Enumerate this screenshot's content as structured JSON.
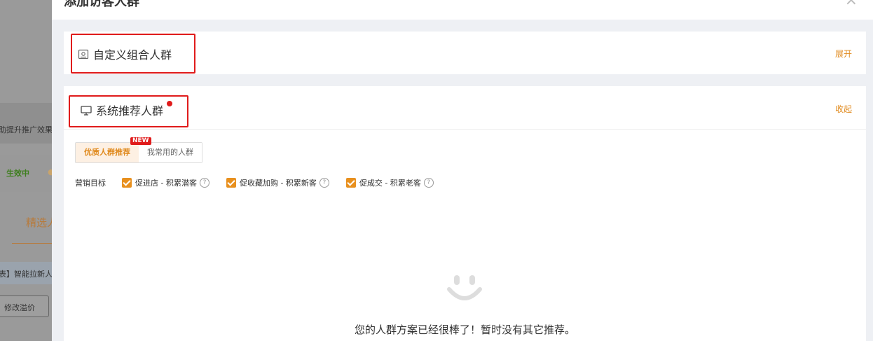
{
  "background": {
    "strip1_text": "助提升推广效果",
    "status_text": "生效中",
    "tab_text": "精选人",
    "row_text": "表】智能拉新人",
    "button_label": "修改溢价"
  },
  "modal": {
    "title": "添加访客人群"
  },
  "custom_panel": {
    "title": "自定义组合人群",
    "action": "展开"
  },
  "system_panel": {
    "title": "系统推荐人群",
    "action": "收起",
    "tabs": [
      {
        "label": "优质人群推荐",
        "active": true
      },
      {
        "label": "我常用的人群",
        "active": false
      }
    ],
    "new_badge": "NEW",
    "goal_label": "营销目标",
    "goals": [
      {
        "label": "促进店 - 积累潜客",
        "checked": true
      },
      {
        "label": "促收藏加购 - 积累新客",
        "checked": true
      },
      {
        "label": "促成交 - 积累老客",
        "checked": true
      }
    ],
    "empty_text": "您的人群方案已经很棒了！暂时没有其它推荐。"
  },
  "colors": {
    "accent": "#e08a1e",
    "highlight_box": "#e01b1b",
    "badge": "#e01b1b"
  }
}
